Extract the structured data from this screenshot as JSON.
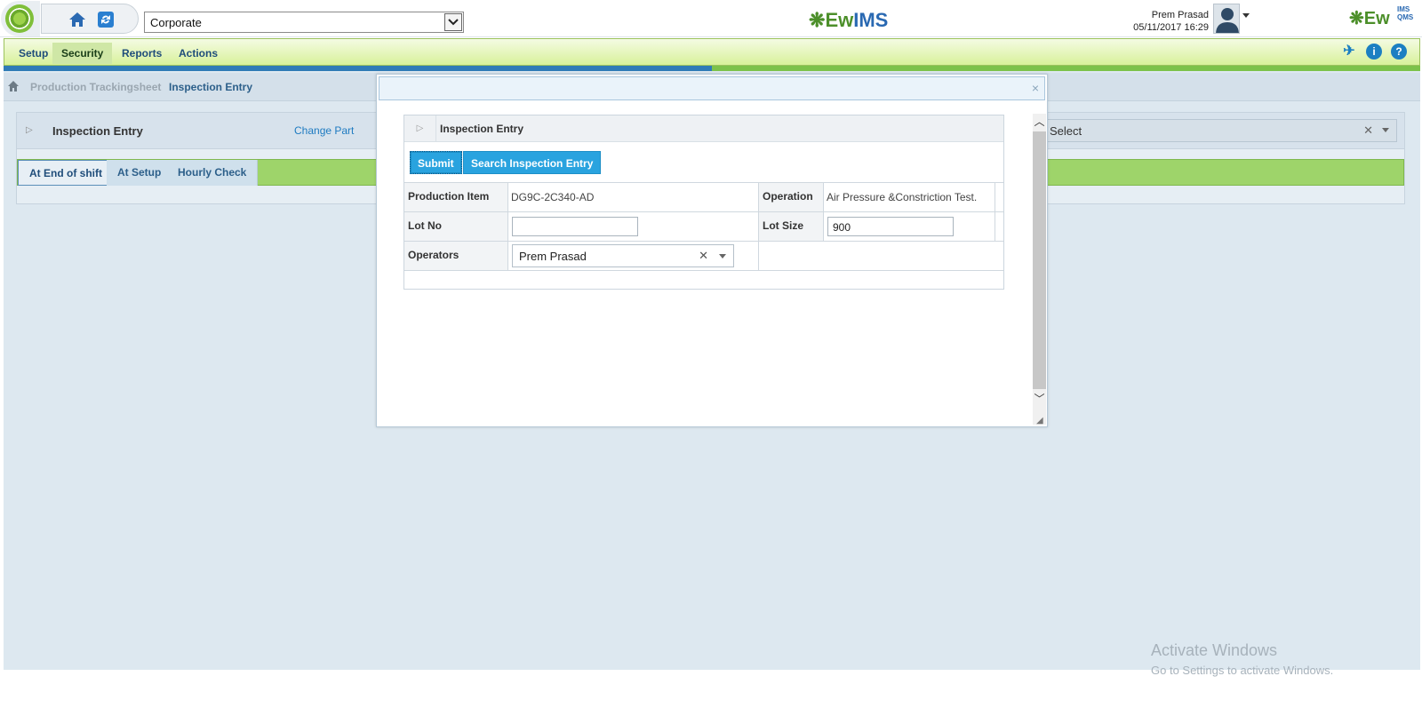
{
  "header": {
    "org_select": "Corporate",
    "center_logo": {
      "ew": "Ew",
      "ims": "IMS"
    },
    "right_logo": {
      "text": "Ew",
      "sup_top": "IMS",
      "sup_bottom": "QMS"
    },
    "user_name": "Prem Prasad",
    "datetime": "05/11/2017 16:29"
  },
  "menu": {
    "items": [
      {
        "label": "Setup"
      },
      {
        "label": "Security"
      },
      {
        "label": "Reports"
      },
      {
        "label": "Actions"
      }
    ]
  },
  "breadcrumb": {
    "items": [
      "Production Trackingsheet",
      "Inspection Entry"
    ]
  },
  "panel": {
    "title": "Inspection Entry",
    "change_part": "Change Part",
    "select_value": "Select",
    "tabs": [
      {
        "label": "At End of shift"
      },
      {
        "label": "At Setup"
      },
      {
        "label": "Hourly Check"
      }
    ]
  },
  "modal": {
    "close": "×",
    "inner_title": "Inspection Entry",
    "buttons": {
      "submit": "Submit",
      "search": "Search Inspection Entry"
    },
    "fields": {
      "production_item_label": "Production Item",
      "production_item_value": "DG9C-2C340-AD",
      "operation_label": "Operation",
      "operation_value": "Air Pressure &Constriction Test.",
      "lot_no_label": "Lot No",
      "lot_no_value": "",
      "lot_size_label": "Lot Size",
      "lot_size_value": "900",
      "operators_label": "Operators",
      "operators_value": "Prem Prasad"
    }
  },
  "watermark": {
    "line1": "Activate Windows",
    "line2": "Go to Settings to activate Windows."
  },
  "colors": {
    "accent_blue": "#29a3df",
    "menu_green": "#d8f19a",
    "tab_green": "#9ed46a",
    "link_blue": "#1e7bc1"
  }
}
